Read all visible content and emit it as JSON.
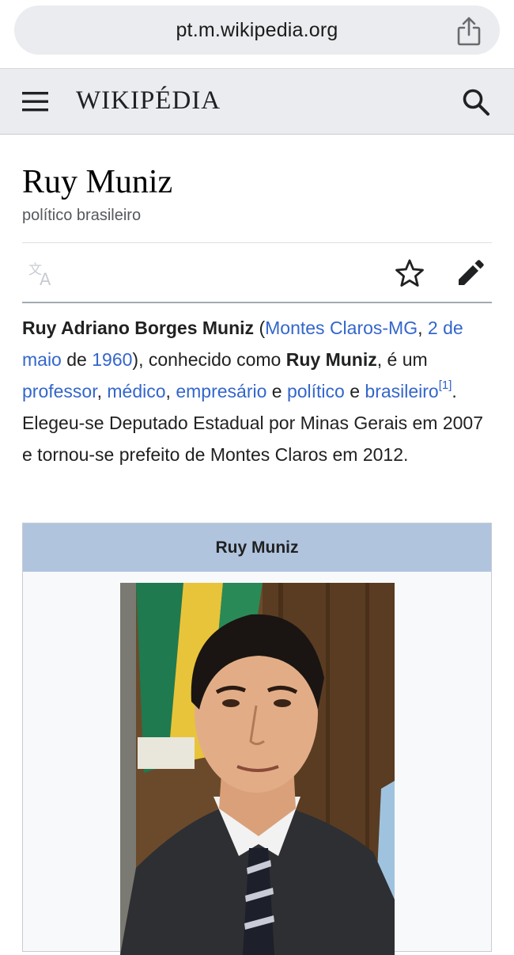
{
  "browser": {
    "url": "pt.m.wikipedia.org"
  },
  "header": {
    "logo": "WIKIPÉDIA"
  },
  "article": {
    "title": "Ruy Muniz",
    "subtitle": "político brasileiro"
  },
  "lead": {
    "bold_name": "Ruy Adriano Borges Muniz",
    "t1": " (",
    "link_place": "Montes Claros-MG",
    "t2": ", ",
    "link_date": "2 de maio",
    "t3": " de ",
    "link_year": "1960",
    "t4": "), conhecido como ",
    "bold_short": "Ruy Muniz",
    "t5": ", é um ",
    "link_professor": "professor",
    "t6": ", ",
    "link_medico": "médico",
    "t7": ", ",
    "link_empresario": "empresário",
    "t8": " e ",
    "link_politico": "político",
    "t9": " e ",
    "link_brasileiro": "brasileiro",
    "ref": "[1]",
    "t10": ". Elegeu-se Deputado Estadual por Minas Gerais em 2007 e tornou-se prefeito de Montes Claros em 2012."
  },
  "infobox": {
    "title": "Ruy Muniz"
  },
  "colors": {
    "link": "#3366cc",
    "infobox_header": "#b0c4de",
    "header_bg": "#eaecf0"
  },
  "icons": [
    "share-icon",
    "menu-icon",
    "search-icon",
    "translate-icon",
    "star-icon",
    "edit-icon"
  ]
}
